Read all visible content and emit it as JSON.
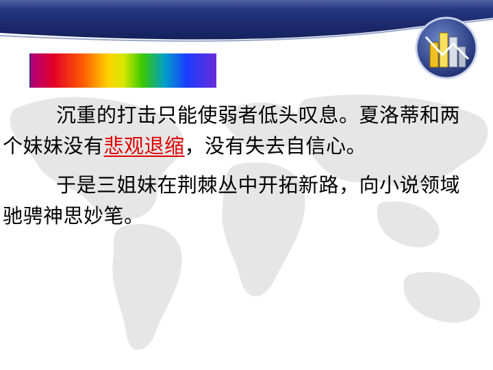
{
  "paragraphs": [
    {
      "before": "沉重的打击只能使弱者低头叹息。夏洛蒂和两个妹妹没有",
      "highlight": "悲观退缩",
      "after": "，没有失去自信心。"
    },
    {
      "before": "于是三姐妹在荆棘丛中开拓新路，向小说领域驰骋神思妙笔。",
      "highlight": "",
      "after": ""
    }
  ],
  "colors": {
    "header": "#1c2b6e",
    "highlight": "#e00000",
    "text": "#000000"
  },
  "icons": {
    "logo": "bar-chart-globe-icon",
    "decor": "rainbow-spectrum-bar"
  }
}
